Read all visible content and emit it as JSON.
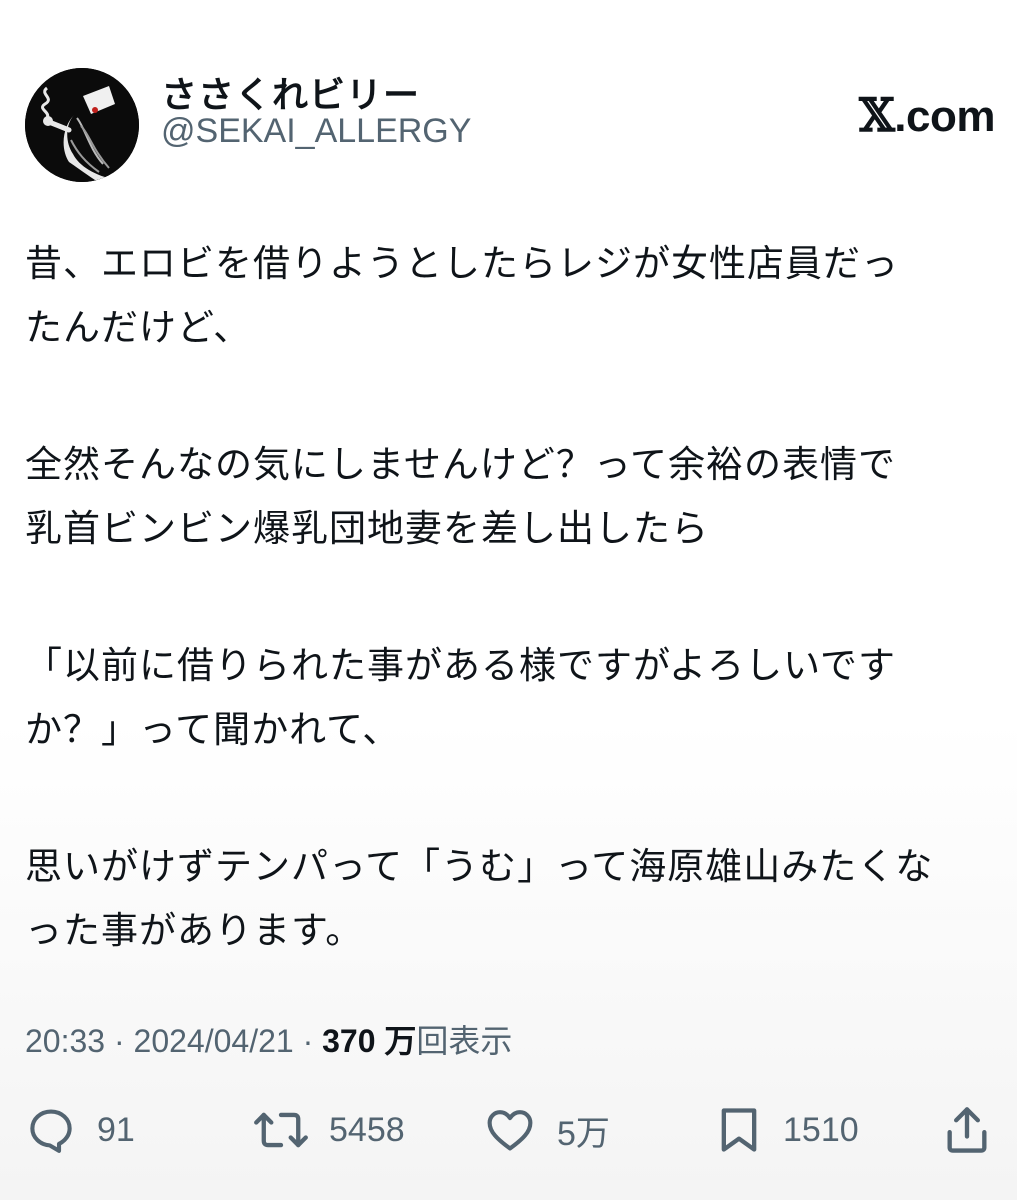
{
  "header": {
    "display_name": "ささくれビリー",
    "handle": "@SEKAI_ALLERGY",
    "brand_mark": "𝕏",
    "brand_suffix": ".com"
  },
  "tweet": {
    "paragraphs": [
      [
        "昔、エロビを借りようとしたらレジが女性店員だっ",
        "たんだけど、"
      ],
      [
        "全然そんなの気にしませんけど？って余裕の表情で",
        "乳首ビンビン爆乳団地妻を差し出したら"
      ],
      [
        "「以前に借りられた事がある様ですがよろしいです",
        "か？」って聞かれて、"
      ],
      [
        "思いがけずテンパって「うむ」って海原雄山みたくな",
        "った事があります。"
      ]
    ]
  },
  "meta": {
    "time": "20:33",
    "date": "2024/04/21",
    "views_number": "370 万",
    "views_label": "回表示",
    "separator": " · "
  },
  "actions": {
    "reply": {
      "icon": "reply-icon",
      "count": "91"
    },
    "retweet": {
      "icon": "retweet-icon",
      "count": "5458"
    },
    "like": {
      "icon": "heart-icon",
      "count": "5万"
    },
    "bookmark": {
      "icon": "bookmark-icon",
      "count": "1510"
    },
    "share": {
      "icon": "share-icon"
    }
  },
  "colors": {
    "text": "#0f1419",
    "secondary": "#536471",
    "background": "#ffffff"
  }
}
